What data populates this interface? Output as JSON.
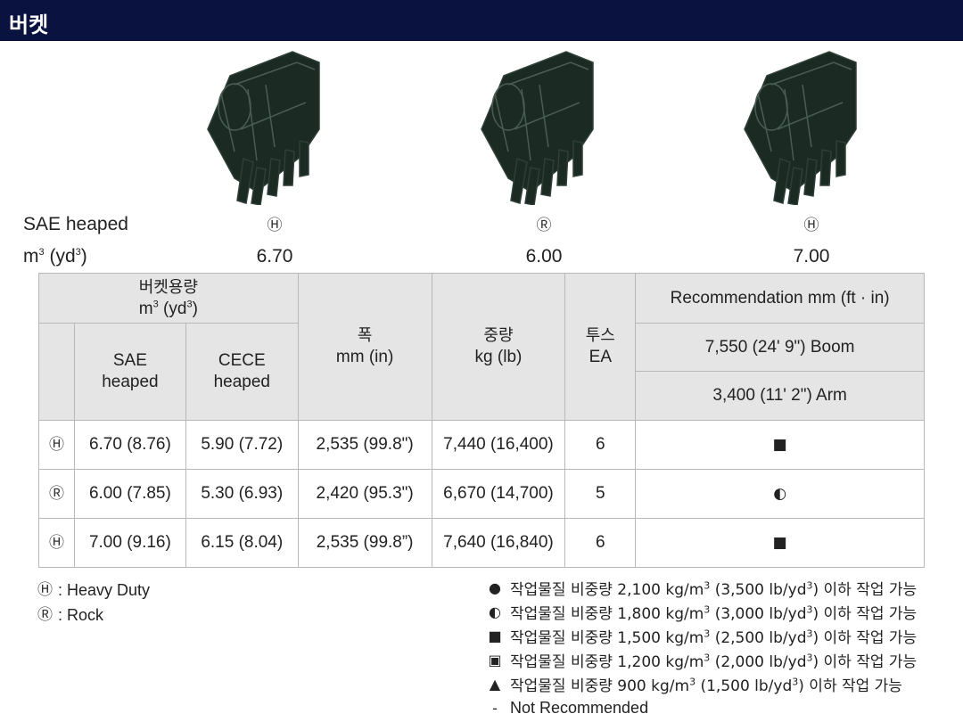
{
  "header": {
    "title": "버켓"
  },
  "buckets": [
    {
      "icon": "bucket-illustration",
      "type_mark": "Ⓗ",
      "capacity": "6.70"
    },
    {
      "icon": "bucket-illustration",
      "type_mark": "Ⓡ",
      "capacity": "6.00"
    },
    {
      "icon": "bucket-illustration",
      "type_mark": "Ⓗ",
      "capacity": "7.00"
    }
  ],
  "summary": {
    "label_line1": "SAE heaped",
    "label_line2_base": "m",
    "label_line2_sup": "3",
    "label_line2_mid": " (yd",
    "label_line2_sup2": "3",
    "label_line2_end": ")"
  },
  "table": {
    "headers": {
      "capacity_line1": "버켓용량",
      "capacity_line2_base": "m",
      "capacity_line2_sup": "3",
      "capacity_line2_mid": " (yd",
      "capacity_line2_sup2": "3",
      "capacity_line2_end": ")",
      "sae_line1": "SAE",
      "sae_line2": "heaped",
      "cece_line1": "CECE",
      "cece_line2": "heaped",
      "width_line1": "폭",
      "width_line2": "mm (in)",
      "weight_line1": "중량",
      "weight_line2": "kg (lb)",
      "teeth_line1": "투스",
      "teeth_line2": "EA",
      "recommendation": "Recommendation mm (ft · in)",
      "boom": "7,550 (24' 9\") Boom",
      "arm": "3,400 (11' 2\") Arm"
    },
    "rows": [
      {
        "type": "Ⓗ",
        "sae": "6.70 (8.76)",
        "cece": "5.90 (7.72)",
        "width": "2,535 (99.8\")",
        "weight": "7,440 (16,400)",
        "teeth": "6",
        "rec": "■"
      },
      {
        "type": "Ⓡ",
        "sae": "6.00 (7.85)",
        "cece": "5.30 (6.93)",
        "width": "2,420 (95.3\")",
        "weight": "6,670 (14,700)",
        "teeth": "5",
        "rec": "◐"
      },
      {
        "type": "Ⓗ",
        "sae": "7.00 (9.16)",
        "cece": "6.15 (8.04)",
        "width": "2,535 (99.8”)",
        "weight": "7,640 (16,840)",
        "teeth": "6",
        "rec": "■"
      }
    ]
  },
  "legend_types": [
    {
      "mark": "Ⓗ",
      "text": ": Heavy Duty"
    },
    {
      "mark": "Ⓡ",
      "text": ": Rock"
    }
  ],
  "legend_density": [
    {
      "mark": "●",
      "pre": "작업물질 비중량 2,100 kg/m",
      "mid": " (3,500 lb/yd",
      "post": ") 이하 작업 가능"
    },
    {
      "mark": "◐",
      "pre": "작업물질 비중량 1,800 kg/m",
      "mid": " (3,000 lb/yd",
      "post": ") 이하 작업 가능"
    },
    {
      "mark": "■",
      "pre": "작업물질 비중량 1,500 kg/m",
      "mid": " (2,500 lb/yd",
      "post": ") 이하 작업 가능"
    },
    {
      "mark": "▣",
      "pre": "작업물질 비중량 1,200 kg/m",
      "mid": " (2,000 lb/yd",
      "post": ") 이하 작업 가능"
    },
    {
      "mark": "▲",
      "pre": "작업물질 비중량 900 kg/m",
      "mid": " (1,500 lb/yd",
      "post": ") 이하 작업 가능"
    }
  ],
  "legend_sup": "3",
  "not_recommended": {
    "mark": "-",
    "text": "Not Recommended"
  },
  "colors": {
    "header_bg": "#0a1240",
    "bucket_fill": "#1c2a24",
    "table_header_bg": "#e5e5e5",
    "grid": "#b8b8b8"
  }
}
